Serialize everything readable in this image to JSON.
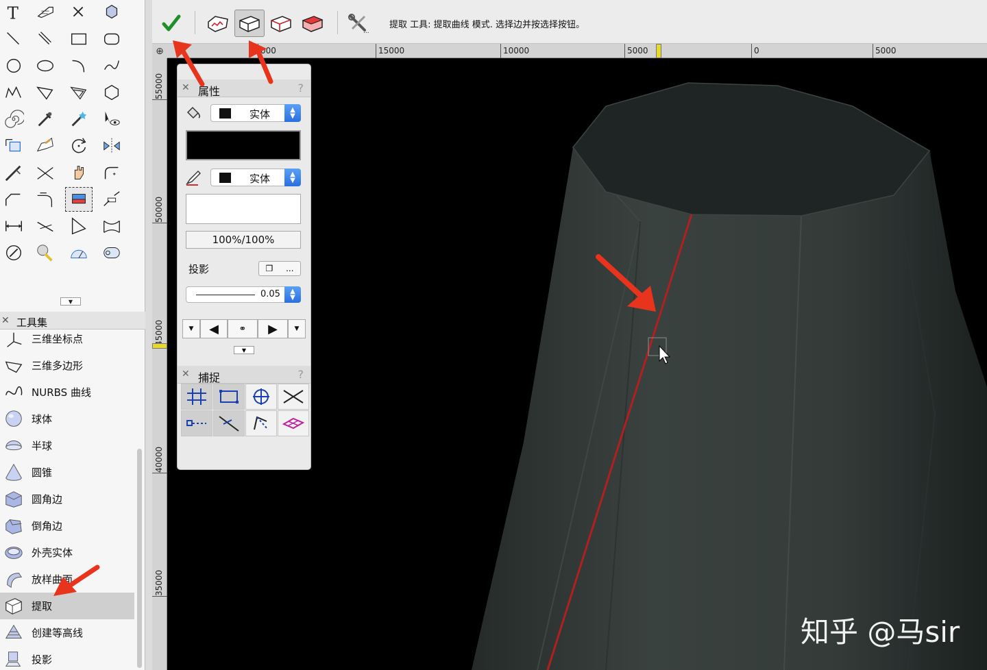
{
  "mode_bar": {
    "help_text": "提取 工具: 提取曲线 模式. 选择边并按选择按钮。",
    "buttons": [
      "confirm-check-icon",
      "extract-face-mode-icon",
      "extract-edge-mode-icon",
      "extract-surface-mode-icon",
      "extract-solid-mode-icon",
      "tool-preferences-icon"
    ]
  },
  "rulers": {
    "top_labels": [
      "000",
      "15000",
      "10000",
      "5000",
      "0",
      "5000"
    ],
    "left_labels": [
      "55000",
      "50000",
      "45000",
      "40000",
      "35000"
    ]
  },
  "attributes_panel": {
    "title": "属性",
    "help": "?",
    "fill_style": "实体",
    "pen_style": "实体",
    "opacity": "100%/100%",
    "shadow_label": "投影",
    "shadow_more": "...",
    "line_weight": "0.05",
    "fill_color": "#000000",
    "pen_color": "#ffffff"
  },
  "snap_panel": {
    "title": "捕捉",
    "help": "?"
  },
  "toolset": {
    "title": "工具集",
    "items": [
      {
        "label": "三维坐标点",
        "icon": "3d-locus-icon"
      },
      {
        "label": "三维多边形",
        "icon": "3d-polygon-icon"
      },
      {
        "label": "NURBS 曲线",
        "icon": "nurbs-curve-icon"
      },
      {
        "label": "球体",
        "icon": "sphere-icon"
      },
      {
        "label": "半球",
        "icon": "hemisphere-icon"
      },
      {
        "label": "圆锥",
        "icon": "cone-icon"
      },
      {
        "label": "圆角边",
        "icon": "fillet-edge-icon"
      },
      {
        "label": "倒角边",
        "icon": "chamfer-edge-icon"
      },
      {
        "label": "外壳实体",
        "icon": "shell-solid-icon"
      },
      {
        "label": "放样曲面",
        "icon": "loft-surface-icon"
      },
      {
        "label": "提取",
        "icon": "extract-icon"
      },
      {
        "label": "创建等高线",
        "icon": "create-contours-icon"
      },
      {
        "label": "投影",
        "icon": "project-icon"
      }
    ],
    "active_index": 10
  },
  "viewport": {
    "background": "#000000",
    "model_color": "#2f3633",
    "highlight_edge_color": "#b02020"
  },
  "watermark": "知乎 @马sir",
  "colors": {
    "annotation_arrow": "#e8341c",
    "selection_blue": "#2a6fe0"
  }
}
